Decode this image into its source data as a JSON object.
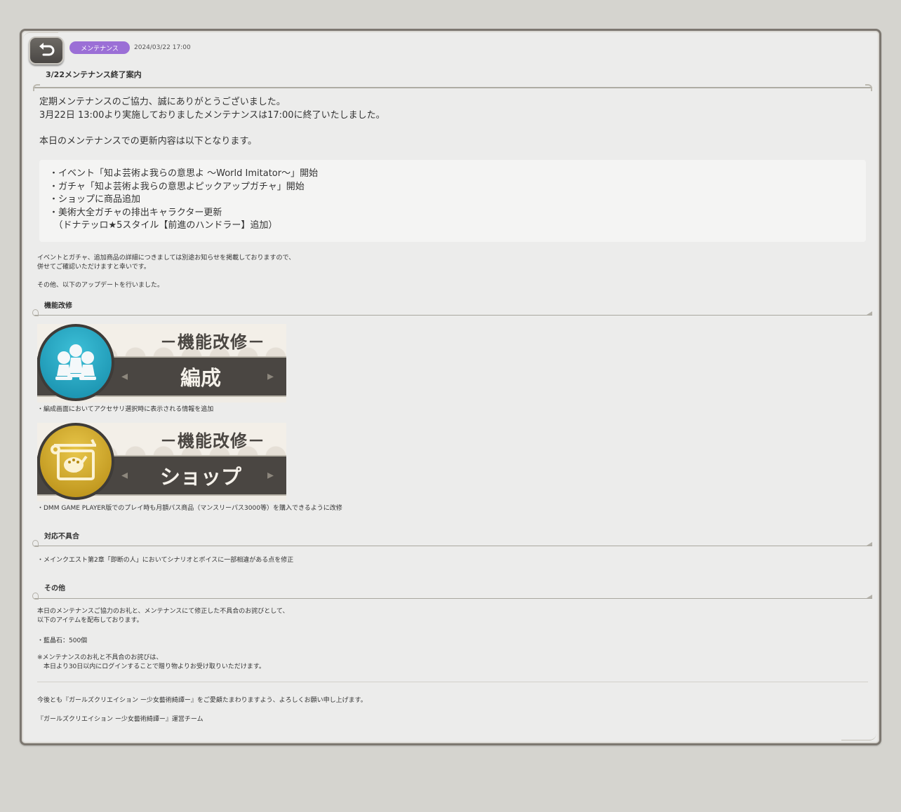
{
  "header": {
    "badge": "メンテナンス",
    "date": "2024/03/22 17:00",
    "title": "3/22メンテナンス終了案内"
  },
  "intro": {
    "line1": "定期メンテナンスのご協力、誠にありがとうございました。",
    "line2": "3月22日 13:00より実施しておりましたメンテナンスは17:00に終了いたしました。",
    "line3": "本日のメンテナンスでの更新内容は以下となります。"
  },
  "updates": [
    "・イベント「知よ芸術よ我らの意思よ 〜World Imitator〜」開始",
    "・ガチャ「知よ芸術よ我らの意思よピックアップガチャ」開始",
    "・ショップに商品追加",
    "・美術大全ガチャの排出キャラクター更新",
    "　（ドナテッロ★5スタイル【前進のハンドラー】追加）"
  ],
  "notes": {
    "line1": "イベントとガチャ、追加商品の詳細につきましては別途お知らせを掲載しておりますので、",
    "line2": "併せてご確認いただけますと幸いです。",
    "line3": "その他、以下のアップデートを行いました。"
  },
  "section_improvements": {
    "title": "機能改修",
    "banner1": {
      "sub": "－機能改修－",
      "main": "編成",
      "caption": "・編成画面においてアクセサリ選択時に表示される情報を追加"
    },
    "banner2": {
      "sub": "－機能改修－",
      "main": "ショップ",
      "caption": "・DMM GAME PLAYER版でのプレイ時も月額パス商品（マンスリーパス3000等）を購入できるように改修"
    }
  },
  "section_bugs": {
    "title": "対応不具合",
    "item": "・メインクエスト第2章「即断の人」においてシナリオとボイスに一部相違がある点を修正"
  },
  "section_other": {
    "title": "その他",
    "line1": "本日のメンテナンスご協力のお礼と、メンテナンスにて修正した不具合のお詫びとして、",
    "line2": "以下のアイテムを配布しております。",
    "item": "・藍晶石：500個",
    "note1": "※メンテナンスのお礼と不具合のお詫びは、",
    "note2": "　本日より30日以内にログインすることで贈り物よりお受け取りいただけます。"
  },
  "footer": {
    "line1": "今後とも『ガールズクリエイション ー少女藝術綺譚ー』をご愛顧たまわりますよう、よろしくお願い申し上げます。",
    "line2": "『ガールズクリエイション ー少女藝術綺譚ー』運営チーム"
  },
  "colors": {
    "badge": "#9b6fd6",
    "panel": "#ececeb",
    "background": "#d5d4cf",
    "banner_bar": "#4a4642"
  },
  "icons": {
    "back": "back-arrow-icon",
    "formation": "pawns-icon",
    "shop": "shop-sign-icon"
  }
}
